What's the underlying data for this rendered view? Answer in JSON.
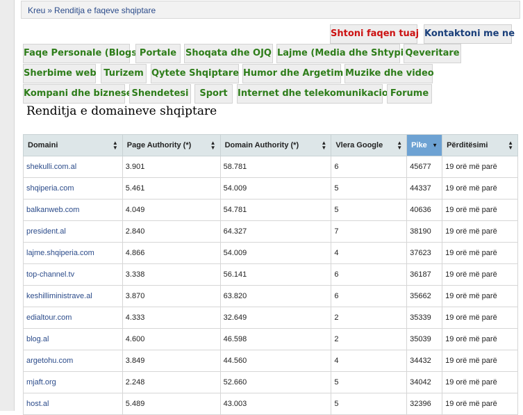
{
  "breadcrumb": {
    "home": "Kreu",
    "separator": "»",
    "current": "Renditja e faqeve shqiptare"
  },
  "actions": {
    "add_page": "Shtoni faqen tuaj",
    "contact": "Kontaktoni me ne"
  },
  "categories": [
    "Faqe Personale (Blogs)",
    "Portale",
    "Shoqata dhe OJQ",
    "Lajme (Media dhe Shtypi)",
    "Qeveritare",
    "Sherbime web",
    "Turizem",
    "Qytete Shqiptare",
    "Humor dhe Argetim",
    "Muzike dhe video",
    "Kompani dhe biznese",
    "Shendetesi",
    "Sport",
    "Internet dhe telekomunikacion",
    "Forume"
  ],
  "page_title": "Renditja e domaineve shqiptare",
  "table": {
    "headers": [
      "Domaini",
      "Page Authority (*)",
      "Domain Authority (*)",
      "Vlera Google",
      "Pike",
      "Përditësimi"
    ],
    "rows": [
      [
        "shekulli.com.al",
        "3.901",
        "58.781",
        "6",
        "45677",
        "19 orë më parë"
      ],
      [
        "shqiperia.com",
        "5.461",
        "54.009",
        "5",
        "44337",
        "19 orë më parë"
      ],
      [
        "balkanweb.com",
        "4.049",
        "54.781",
        "5",
        "40636",
        "19 orë më parë"
      ],
      [
        "president.al",
        "2.840",
        "64.327",
        "7",
        "38190",
        "19 orë më parë"
      ],
      [
        "lajme.shqiperia.com",
        "4.866",
        "54.009",
        "4",
        "37623",
        "19 orë më parë"
      ],
      [
        "top-channel.tv",
        "3.338",
        "56.141",
        "6",
        "36187",
        "19 orë më parë"
      ],
      [
        "keshilliministrave.al",
        "3.870",
        "63.820",
        "6",
        "35662",
        "19 orë më parë"
      ],
      [
        "edialtour.com",
        "4.333",
        "32.649",
        "2",
        "35339",
        "19 orë më parë"
      ],
      [
        "blog.al",
        "4.600",
        "46.598",
        "2",
        "35039",
        "19 orë më parë"
      ],
      [
        "argetohu.com",
        "3.849",
        "44.560",
        "4",
        "34432",
        "19 orë më parë"
      ],
      [
        "mjaft.org",
        "2.248",
        "52.660",
        "5",
        "34042",
        "19 orë më parë"
      ],
      [
        "host.al",
        "5.489",
        "43.003",
        "5",
        "32396",
        "19 orë më parë"
      ]
    ]
  }
}
